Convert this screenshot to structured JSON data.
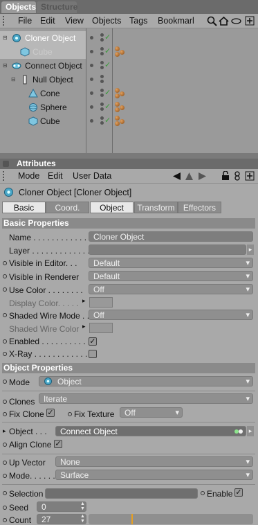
{
  "tabs": {
    "objects": "Objects",
    "structure": "Structure"
  },
  "menu": {
    "file": "File",
    "edit": "Edit",
    "view": "View",
    "objects": "Objects",
    "tags": "Tags",
    "bookmarks": "Bookmarl"
  },
  "objects": [
    {
      "name": "Cloner Object"
    },
    {
      "name": "Cube"
    },
    {
      "name": "Connect Object"
    },
    {
      "name": "Null Object"
    },
    {
      "name": "Cone"
    },
    {
      "name": "Sphere"
    },
    {
      "name": "Cube"
    }
  ],
  "attributes": {
    "title": "Attributes",
    "menu": {
      "mode": "Mode",
      "edit": "Edit",
      "userdata": "User Data"
    },
    "object_title": "Cloner Object [Cloner Object]",
    "subtabs": {
      "basic": "Basic",
      "coord": "Coord.",
      "object": "Object",
      "transform": "Transform",
      "effectors": "Effectors"
    },
    "basic": {
      "header": "Basic Properties",
      "name_label": "Name . . . . . . . . . . . . .",
      "name_value": "Cloner Object",
      "layer_label": "Layer . . . . . . . . . . . . .",
      "vis_editor_label": "Visible in Editor. . .",
      "vis_editor_value": "Default",
      "vis_render_label": "Visible in Renderer",
      "vis_render_value": "Default",
      "use_color_label": "Use Color . . . . . . . .",
      "use_color_value": "Off",
      "display_color_label": "Display Color. . . . .",
      "shaded_wire_mode_label": "Shaded Wire Mode . .",
      "shaded_wire_mode_value": "Off",
      "shaded_wire_color_label": "Shaded Wire Color",
      "enabled_label": "Enabled . . . . . . . . . . .",
      "enabled_check": "✓",
      "xray_label": "X-Ray . . . . . . . . . . . ."
    },
    "object": {
      "header": "Object Properties",
      "mode_label": "Mode",
      "mode_value": "Object",
      "clones_label": "Clones",
      "clones_value": "Iterate",
      "fix_clone_label": "Fix Clone",
      "fix_clone_check": "✓",
      "fix_texture_label": "Fix Texture",
      "fix_texture_value": "Off",
      "object_label": "Object . . .",
      "object_value": "Connect Object",
      "align_clone_label": "Align Clone",
      "align_clone_check": "✓",
      "up_vector_label": "Up Vector",
      "up_vector_value": "None",
      "mode2_label": "Mode. . . . . . .",
      "mode2_value": "Surface",
      "selection_label": "Selection",
      "enable_label": "Enable",
      "enable_check": "✓",
      "seed_label": "Seed",
      "seed_value": "0",
      "count_label": "Count",
      "count_value": "27"
    }
  }
}
